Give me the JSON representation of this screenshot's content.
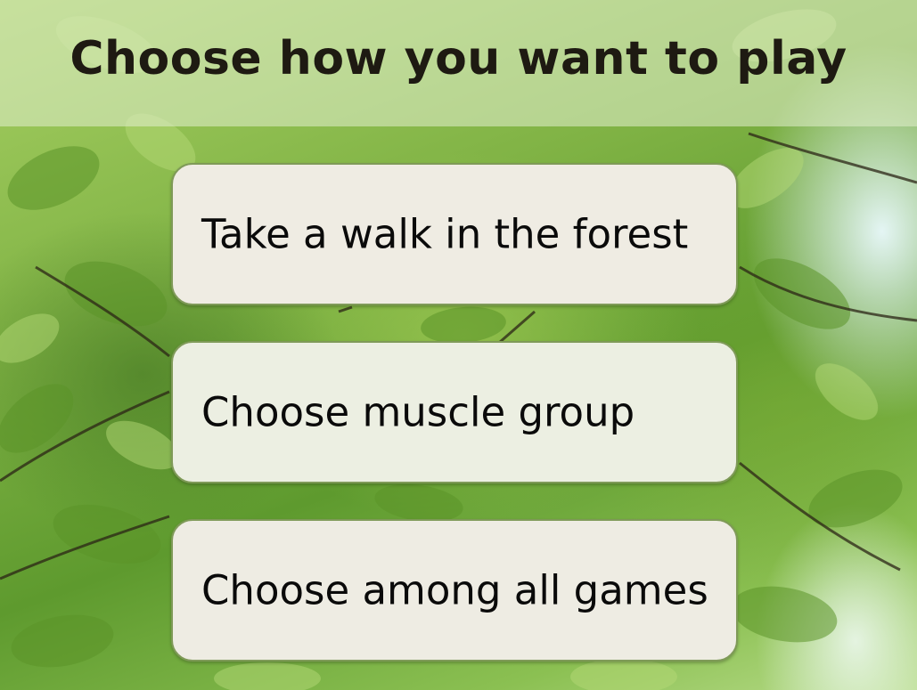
{
  "screen": {
    "title": "Choose how you want to play",
    "background": "forest-leaves-background"
  },
  "options": [
    {
      "label": "Take a walk in the forest"
    },
    {
      "label": "Choose muscle group"
    },
    {
      "label": "Choose among all games"
    }
  ],
  "colors": {
    "title_text": "#1e1a12",
    "button_fill": "#eeebe2",
    "button_border": "#7f9a58",
    "foliage": "#7fb244"
  }
}
